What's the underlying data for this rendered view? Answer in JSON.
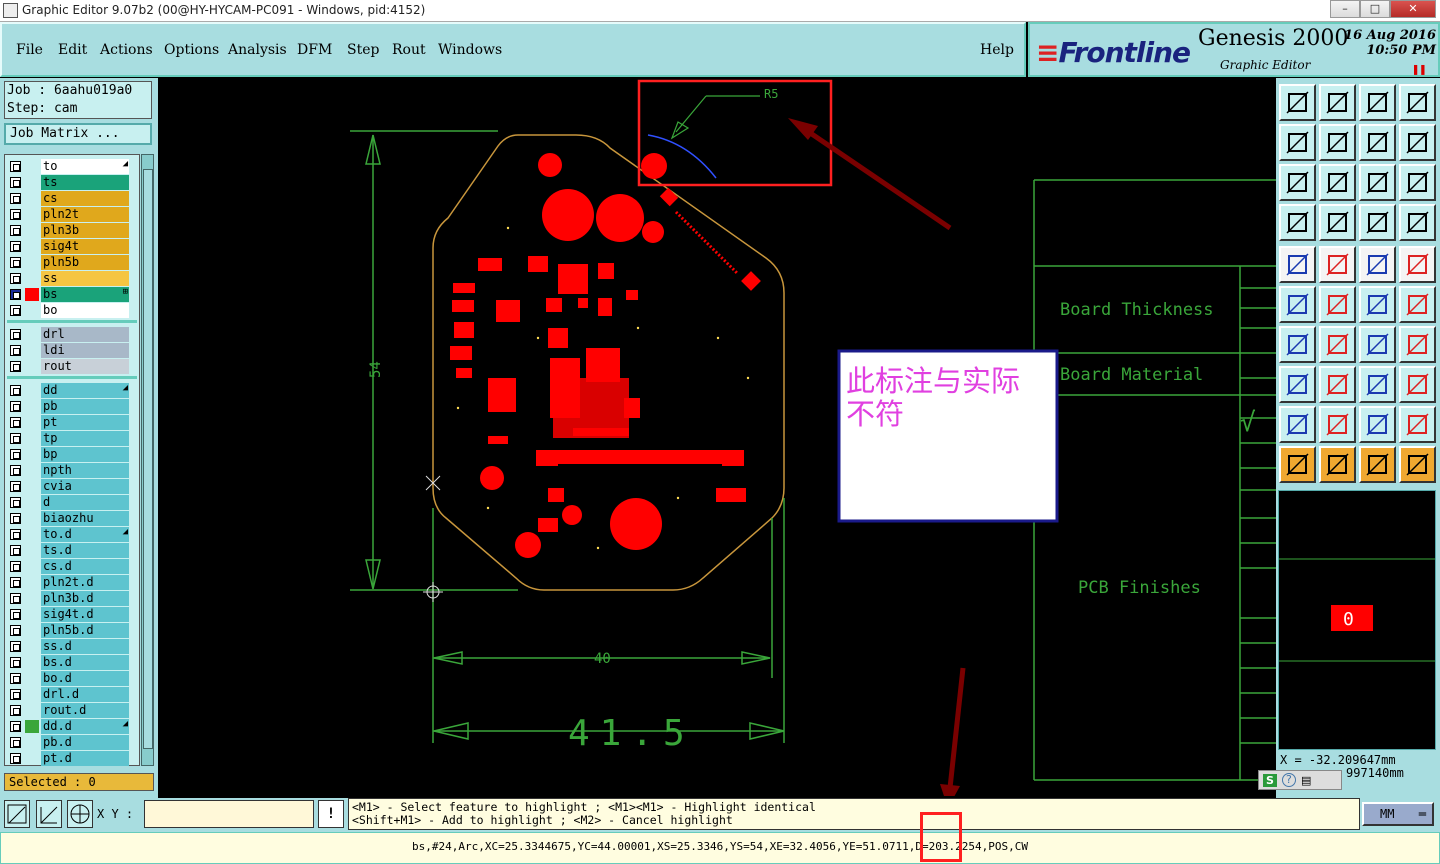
{
  "window": {
    "title": "Graphic Editor 9.07b2 (00@HY-HYCAM-PC091 - Windows, pid:4152)",
    "min": "–",
    "max": "□",
    "close": "✕"
  },
  "menu": {
    "items": [
      "File",
      "Edit",
      "Actions",
      "Options",
      "Analysis",
      "DFM",
      "Step",
      "Rout",
      "Windows"
    ],
    "help": "Help"
  },
  "brand": {
    "logo": "Frontline",
    "product": "Genesis 2000",
    "subtitle": "Graphic Editor",
    "date": "16 Aug 2016",
    "time": "10:50 PM",
    "pause": "❚❚"
  },
  "job": {
    "job_line": "Job : 6aahu019a0",
    "step_line": "Step: cam",
    "matrix_button": "Job Matrix ..."
  },
  "layers": {
    "group1": [
      {
        "name": "to",
        "color": "#ffffff",
        "marker": "◢"
      },
      {
        "name": "ts",
        "color": "#1aa37a"
      },
      {
        "name": "cs",
        "color": "#e0a81c"
      },
      {
        "name": "pln2t",
        "color": "#e0a81c"
      },
      {
        "name": "pln3b",
        "color": "#e0a81c"
      },
      {
        "name": "sig4t",
        "color": "#e0a81c"
      },
      {
        "name": "pln5b",
        "color": "#e0a81c"
      },
      {
        "name": "ss",
        "color": "#f5c542"
      },
      {
        "name": "bs",
        "color": "#1aa37a",
        "active": true,
        "marker": "⊞"
      },
      {
        "name": "bo",
        "color": "#ffffff"
      }
    ],
    "group2": [
      {
        "name": "drl",
        "color": "#a8b8c8"
      },
      {
        "name": "ldi",
        "color": "#a8b8c8"
      },
      {
        "name": "rout",
        "color": "#c8d0d8"
      }
    ],
    "group3": [
      {
        "name": "dd",
        "marker": "◢"
      },
      {
        "name": "pb"
      },
      {
        "name": "pt"
      },
      {
        "name": "tp"
      },
      {
        "name": "bp"
      },
      {
        "name": "npth"
      },
      {
        "name": "cvia"
      },
      {
        "name": "d"
      },
      {
        "name": "biaozhu"
      },
      {
        "name": "to.d",
        "marker": "◢"
      },
      {
        "name": "ts.d"
      },
      {
        "name": "cs.d"
      },
      {
        "name": "pln2t.d"
      },
      {
        "name": "pln3b.d"
      },
      {
        "name": "sig4t.d"
      },
      {
        "name": "pln5b.d"
      },
      {
        "name": "ss.d"
      },
      {
        "name": "bs.d"
      },
      {
        "name": "bo.d"
      },
      {
        "name": "drl.d"
      },
      {
        "name": "rout.d"
      },
      {
        "name": "dd.d",
        "marker": "◢"
      },
      {
        "name": "pb.d"
      },
      {
        "name": "pt.d"
      }
    ],
    "selected": "Selected : 0"
  },
  "canvas": {
    "dim_54": "54",
    "dim_40": "40",
    "dim_415": "41.5",
    "r5": "R5",
    "board_thickness": "Board Thickness",
    "board_material": "Board Material",
    "pcb_finishes": "PCB Finishes",
    "checkmark": "√",
    "annotation_line1": "此标注与实际",
    "annotation_line2": "不符",
    "minimap_label": "0"
  },
  "coords": {
    "x": "X = -32.209647mm",
    "y": "997140mm"
  },
  "bottom": {
    "xy_label": "X Y :",
    "xy_value": "",
    "warn_icon": "!",
    "hint_line1": "<M1> - Select feature to highlight ; <M1><M1> - Highlight identical",
    "hint_line2": "<Shift+M1> - Add to highlight ; <M2> - Cancel highlight",
    "unit": "MM",
    "status": "bs,#24,Arc,XC=25.3344675,YC=44.00001,XS=25.3346,YS=54,XE=32.4056,YE=51.0711,D=203.2254,POS,CW"
  },
  "ime": {
    "s": "S",
    "help": "?"
  },
  "colors": {
    "panel": "#a8dde0",
    "green": "#3aa63a",
    "pad": "#ff0000",
    "outline": "#c8963c",
    "annot": "#ff2020"
  }
}
